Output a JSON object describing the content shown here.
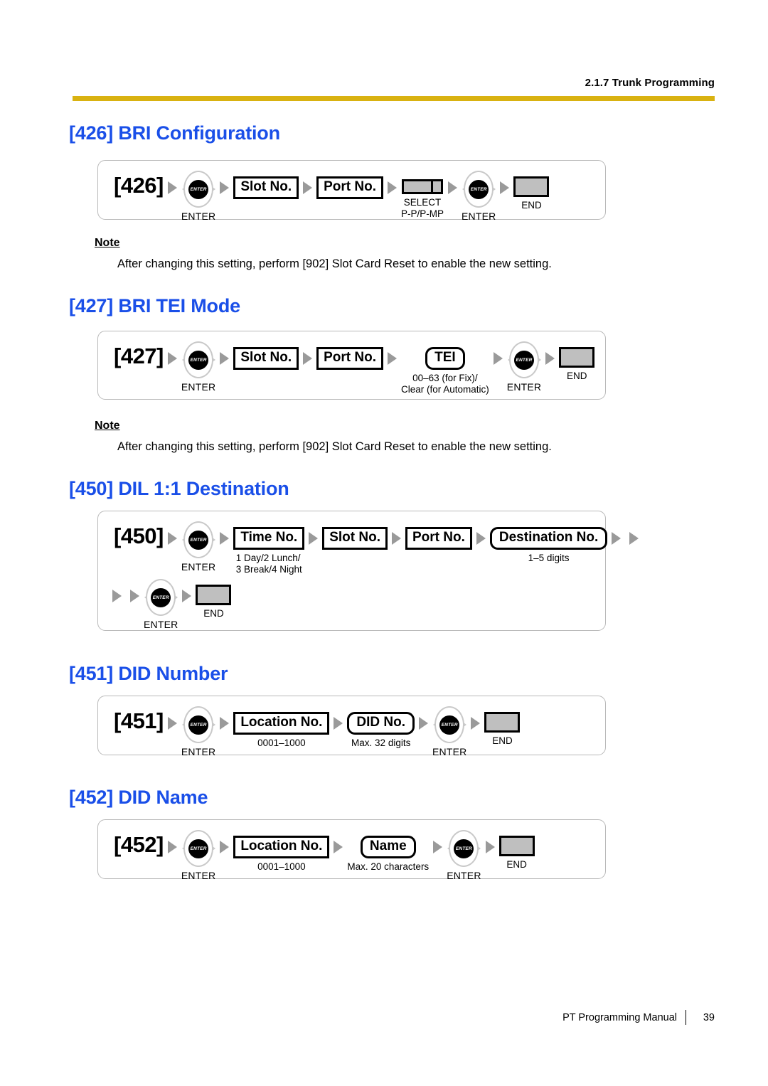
{
  "header": {
    "running_head": "2.1.7 Trunk Programming"
  },
  "footer": {
    "manual": "PT Programming Manual",
    "page": "39"
  },
  "note_label": "Note",
  "note_text": "After changing this setting, perform [902] Slot Card Reset to enable the new setting.",
  "sections": [
    {
      "id": "426",
      "title": "[426] BRI Configuration",
      "code": "[426]",
      "has_note": true,
      "steps": [
        {
          "type": "code",
          "label": "[426]"
        },
        {
          "type": "arrow"
        },
        {
          "type": "nav",
          "caption": "ENTER"
        },
        {
          "type": "arrow"
        },
        {
          "type": "keybox",
          "label": "Slot No.",
          "shape": "sharp"
        },
        {
          "type": "arrow"
        },
        {
          "type": "keybox",
          "label": "Port No.",
          "shape": "sharp"
        },
        {
          "type": "arrow"
        },
        {
          "type": "select",
          "caption": "SELECT\nP-P/P-MP"
        },
        {
          "type": "arrow"
        },
        {
          "type": "nav",
          "caption": "ENTER"
        },
        {
          "type": "arrow"
        },
        {
          "type": "end",
          "caption": "END"
        }
      ]
    },
    {
      "id": "427",
      "title": "[427] BRI TEI Mode",
      "code": "[427]",
      "has_note": true,
      "steps": [
        {
          "type": "code",
          "label": "[427]"
        },
        {
          "type": "arrow"
        },
        {
          "type": "nav",
          "caption": "ENTER"
        },
        {
          "type": "arrow"
        },
        {
          "type": "keybox",
          "label": "Slot No.",
          "shape": "sharp"
        },
        {
          "type": "arrow"
        },
        {
          "type": "keybox",
          "label": "Port No.",
          "shape": "sharp"
        },
        {
          "type": "arrow"
        },
        {
          "type": "keybox",
          "label": "TEI",
          "shape": "round",
          "caption": "00–63 (for Fix)/\nClear (for Automatic)"
        },
        {
          "type": "arrow"
        },
        {
          "type": "nav",
          "caption": "ENTER"
        },
        {
          "type": "arrow"
        },
        {
          "type": "end",
          "caption": "END"
        }
      ]
    },
    {
      "id": "450",
      "title": "[450] DIL 1:1 Destination",
      "code": "[450]",
      "has_note": false,
      "steps": [
        {
          "type": "code",
          "label": "[450]"
        },
        {
          "type": "arrow"
        },
        {
          "type": "nav",
          "caption": "ENTER"
        },
        {
          "type": "arrow"
        },
        {
          "type": "keybox",
          "label": "Time No.",
          "shape": "sharp",
          "caption": "1 Day/2 Lunch/\n3 Break/4 Night",
          "caption_align": "left"
        },
        {
          "type": "arrow"
        },
        {
          "type": "keybox",
          "label": "Slot No.",
          "shape": "sharp"
        },
        {
          "type": "arrow"
        },
        {
          "type": "keybox",
          "label": "Port No.",
          "shape": "sharp"
        },
        {
          "type": "arrow"
        },
        {
          "type": "keybox",
          "label": "Destination No.",
          "shape": "round",
          "caption": "1–5 digits"
        },
        {
          "type": "arrow"
        },
        {
          "type": "arrow"
        }
      ],
      "steps2": [
        {
          "type": "arrow"
        },
        {
          "type": "arrow"
        },
        {
          "type": "nav",
          "caption": "ENTER"
        },
        {
          "type": "arrow"
        },
        {
          "type": "end",
          "caption": "END"
        }
      ]
    },
    {
      "id": "451",
      "title": "[451] DID Number",
      "code": "[451]",
      "has_note": false,
      "steps": [
        {
          "type": "code",
          "label": "[451]"
        },
        {
          "type": "arrow"
        },
        {
          "type": "nav",
          "caption": "ENTER"
        },
        {
          "type": "arrow"
        },
        {
          "type": "keybox",
          "label": "Location No.",
          "shape": "sharp",
          "caption": "0001–1000"
        },
        {
          "type": "arrow"
        },
        {
          "type": "keybox",
          "label": "DID No.",
          "shape": "round",
          "caption": "Max. 32 digits"
        },
        {
          "type": "arrow"
        },
        {
          "type": "nav",
          "caption": "ENTER"
        },
        {
          "type": "arrow"
        },
        {
          "type": "end",
          "caption": "END"
        }
      ]
    },
    {
      "id": "452",
      "title": "[452] DID Name",
      "code": "[452]",
      "has_note": false,
      "steps": [
        {
          "type": "code",
          "label": "[452]"
        },
        {
          "type": "arrow"
        },
        {
          "type": "nav",
          "caption": "ENTER"
        },
        {
          "type": "arrow"
        },
        {
          "type": "keybox",
          "label": "Location No.",
          "shape": "sharp",
          "caption": "0001–1000"
        },
        {
          "type": "arrow"
        },
        {
          "type": "keybox",
          "label": "Name",
          "shape": "round",
          "caption": "Max. 20 characters"
        },
        {
          "type": "arrow"
        },
        {
          "type": "nav",
          "caption": "ENTER"
        },
        {
          "type": "arrow"
        },
        {
          "type": "end",
          "caption": "END"
        }
      ]
    }
  ],
  "nav_key_label": "ENTER",
  "colors": {
    "heading_blue": "#1a4fe8",
    "rule_gold": "#d9b211",
    "key_gray": "#bfbfbf",
    "arrow_gray": "#9a9a9a",
    "card_border": "#b9b9b9"
  }
}
